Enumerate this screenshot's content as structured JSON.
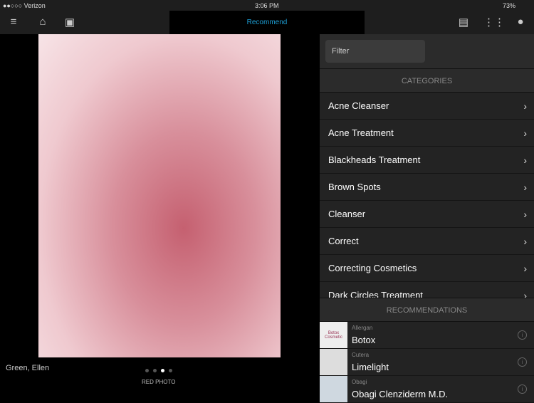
{
  "status": {
    "carrier": "●●○○○ Verizon",
    "time": "3:06 PM",
    "battery": "73%"
  },
  "nav": {
    "title": "Recommend"
  },
  "photo": {
    "patient": "Green, Ellen",
    "label": "RED PHOTO",
    "page_count": 4,
    "current_page": 3
  },
  "panel": {
    "filter_placeholder": "Filter",
    "categories_header": "CATEGORIES",
    "recommendations_header": "RECOMMENDATIONS",
    "categories": [
      "Acne Cleanser",
      "Acne Treatment",
      "Blackheads Treatment",
      "Brown Spots",
      "Cleanser",
      "Correct",
      "Correcting Cosmetics",
      "Dark Circles Treatment"
    ],
    "recommendations": [
      {
        "brand": "Allergan",
        "product": "Botox",
        "thumb": "Botox Cosmetic"
      },
      {
        "brand": "Cutera",
        "product": "Limelight",
        "thumb": ""
      },
      {
        "brand": "Obagi",
        "product": "Obagi Clenziderm M.D.",
        "thumb": ""
      }
    ]
  },
  "colors": {
    "accent": "#1d9fd6"
  }
}
